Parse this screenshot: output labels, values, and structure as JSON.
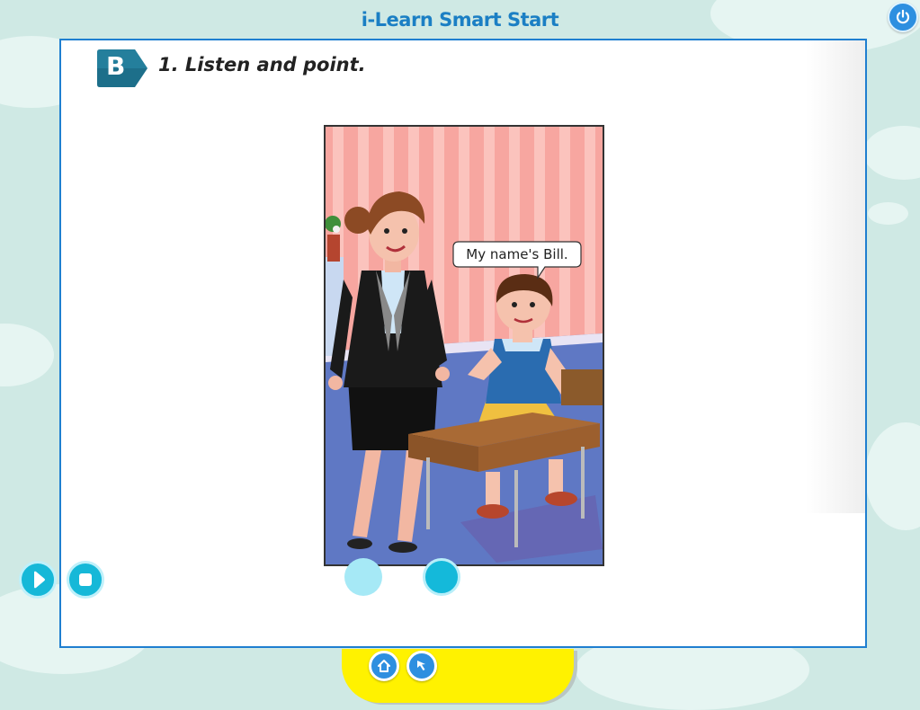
{
  "app": {
    "title": "i-Learn Smart Start"
  },
  "header": {
    "power_icon": "power-icon"
  },
  "activity": {
    "section_letter": "B",
    "instruction": "1. Listen and point.",
    "speech_bubble": "My name's Bill."
  },
  "controls": {
    "play_icon": "play-icon",
    "stop_icon": "stop-icon",
    "pages": [
      {
        "state": "inactive"
      },
      {
        "state": "active"
      }
    ]
  },
  "nav": {
    "home_icon": "home-icon",
    "back_icon": "back-arrow-icon"
  },
  "colors": {
    "accent": "#1f7fd0",
    "control": "#16b8d8",
    "nav_tab": "#fff200",
    "badge": "#1d6f8a",
    "background": "#cfe9e4"
  }
}
